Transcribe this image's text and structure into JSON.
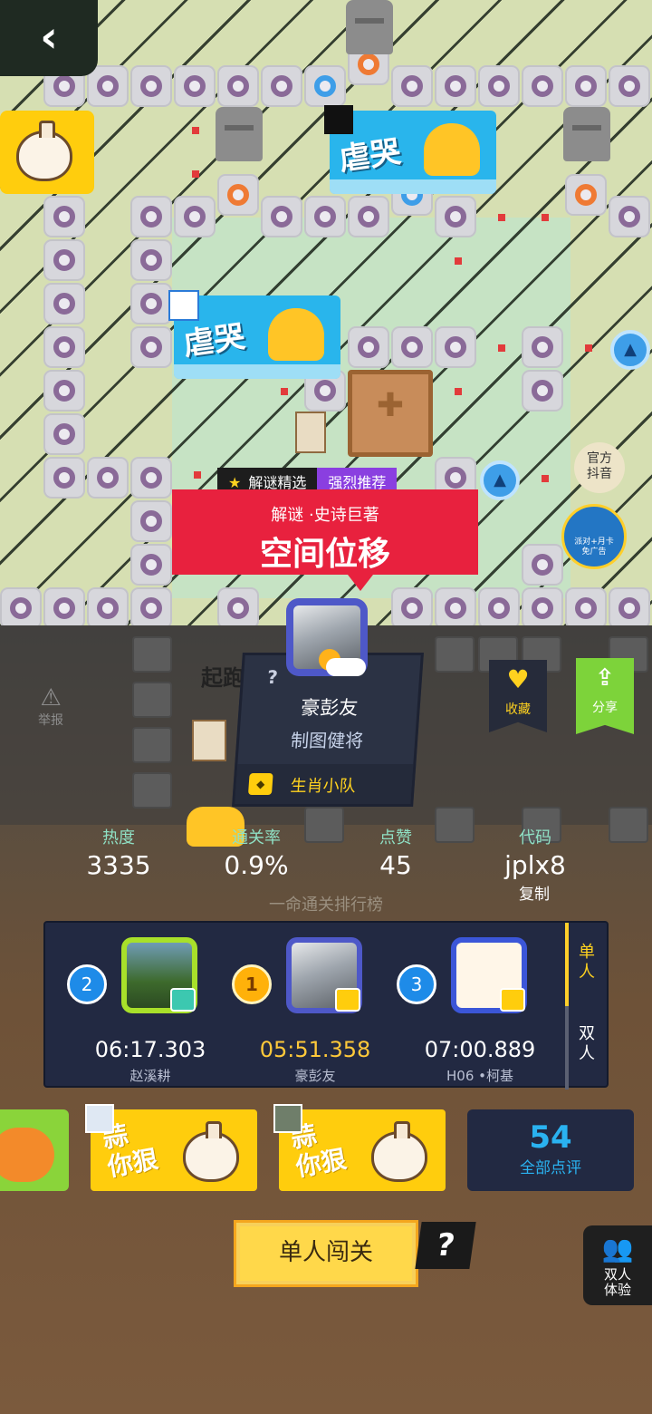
{
  "nav": {
    "back_icon": "‹"
  },
  "map": {
    "stickers": [
      {
        "text": "虐哭"
      },
      {
        "text": "虐哭"
      }
    ],
    "official": {
      "label": "官方\n抖音"
    },
    "promo": {
      "label": "派对+月卡\n免广告"
    },
    "start_label": "起跑"
  },
  "level": {
    "tag_picked": "解谜精选",
    "tag_recommend": "强烈推荐",
    "subtitle": "解谜 ·史诗巨著",
    "title": "空间位移"
  },
  "author": {
    "question": "?",
    "name": "豪彭友",
    "rank_title": "制图健将",
    "team": "生肖小队"
  },
  "actions": {
    "report": "举报",
    "favorite": "收藏",
    "share": "分享"
  },
  "stats": {
    "heat_label": "热度",
    "heat_value": "3335",
    "clear_label": "通关率",
    "clear_value": "0.9%",
    "likes_label": "点赞",
    "likes_value": "45",
    "code_label": "代码",
    "code_value": "jplx8",
    "copy_label": "复制"
  },
  "leaderboard": {
    "title": "一命通关排行榜",
    "entries": [
      {
        "rank": "2",
        "time": "06:17.303",
        "name": "赵溪耕"
      },
      {
        "rank": "1",
        "time": "05:51.358",
        "name": "豪彭友"
      },
      {
        "rank": "3",
        "time": "07:00.889",
        "name": "H06 •柯基"
      }
    ],
    "tab_single": "单人",
    "tab_double": "双人"
  },
  "comments": [
    {
      "text": "蒜\n你狠"
    },
    {
      "text": "蒜\n你狠"
    }
  ],
  "reviews": {
    "count": "54",
    "label": "全部点评"
  },
  "bottom": {
    "play_label": "单人闯关",
    "help_label": "?",
    "duo_label": "双人\n体验"
  },
  "colors": {
    "banner_red": "#e8213e",
    "accent_yellow": "#ffcd0d",
    "board_navy": "#222942",
    "stat_label_green": "#8fe0c4"
  }
}
